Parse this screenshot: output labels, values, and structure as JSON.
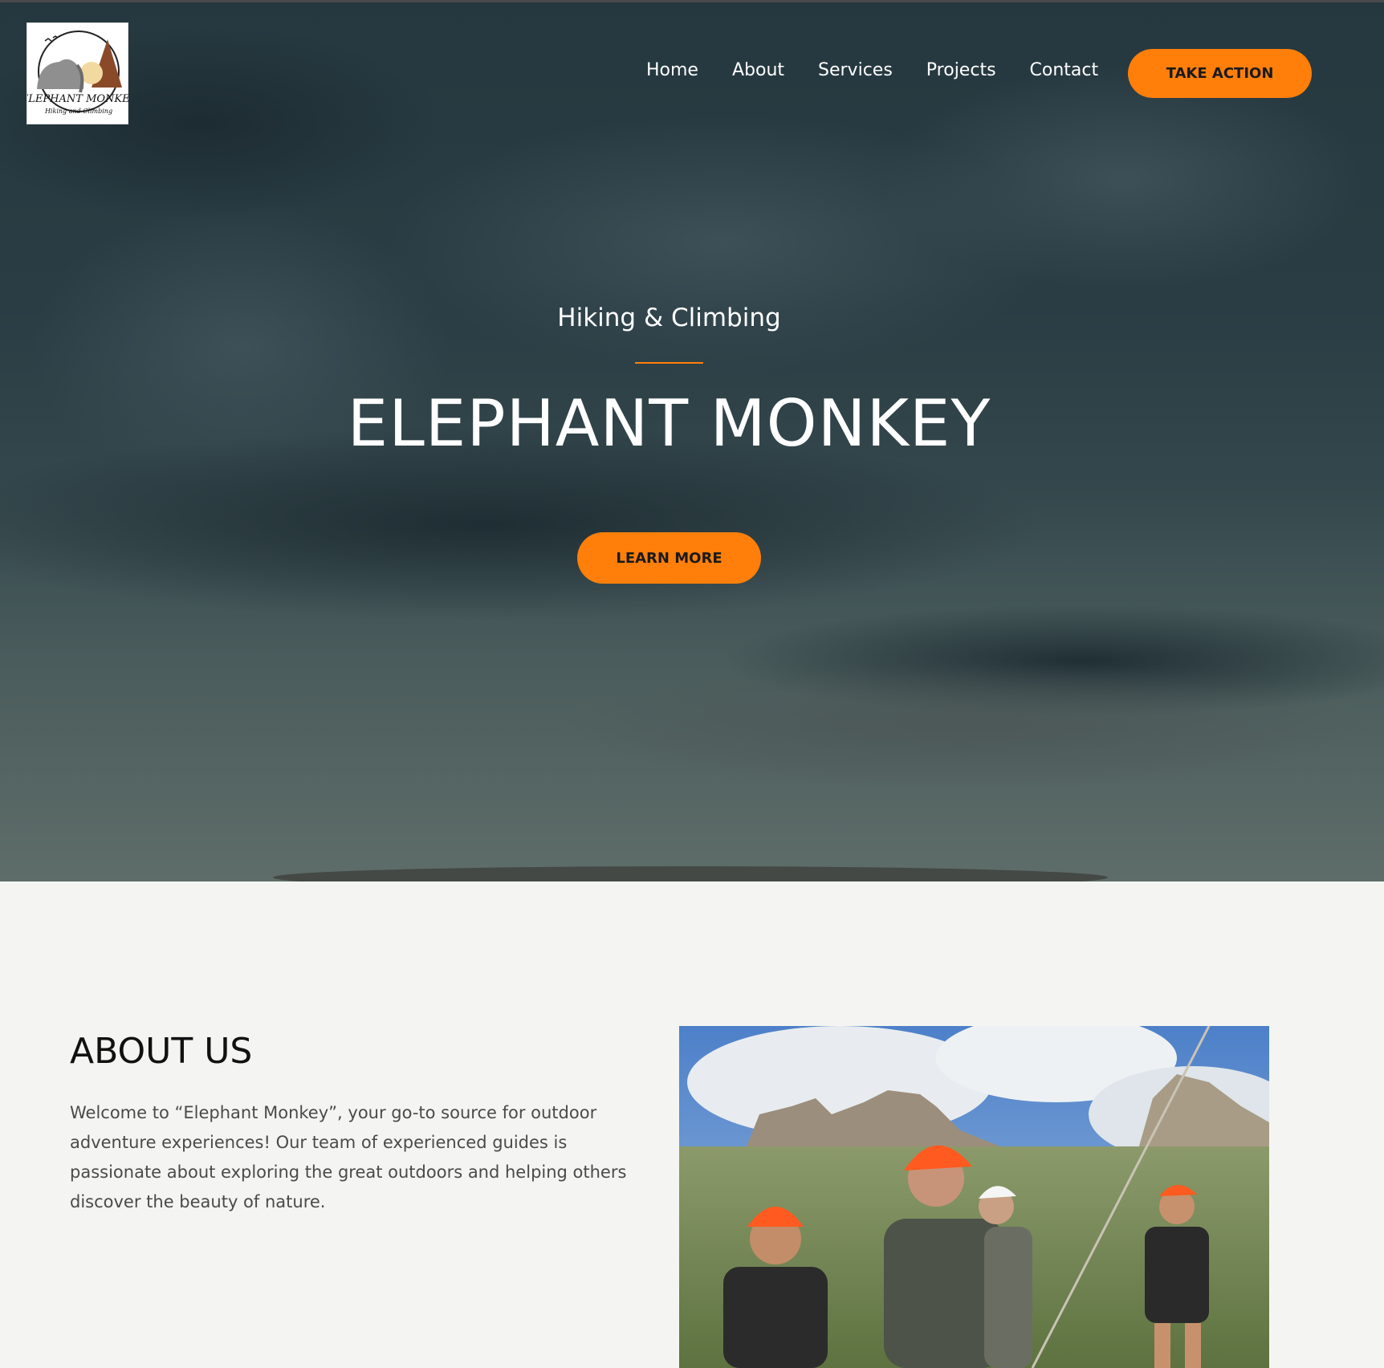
{
  "logo": {
    "alt": "Elephant Monkey Hiking and Climbing logo",
    "wordmark": "ELEPHANT MONKEY",
    "tagline": "Hiking and Climbing"
  },
  "nav": {
    "items": [
      {
        "label": "Home"
      },
      {
        "label": "About"
      },
      {
        "label": "Services"
      },
      {
        "label": "Projects"
      },
      {
        "label": "Contact"
      }
    ],
    "cta_label": "TAKE ACTION"
  },
  "hero": {
    "subtitle": "Hiking & Climbing",
    "title": "ELEPHANT MONKEY",
    "button_label": "LEARN MORE"
  },
  "about": {
    "heading": "ABOUT US",
    "body": "Welcome to “Elephant Monkey”, your go-to source for outdoor adventure experiences! Our team of experienced guides is passionate about exploring the great outdoors and helping others discover the beauty of nature."
  },
  "colors": {
    "accent": "#ff7f0a",
    "hero_bg": "#2a3d44",
    "page_bg": "#f4f5f2",
    "text_dark": "#111111",
    "text_body": "#4a4a4a"
  }
}
